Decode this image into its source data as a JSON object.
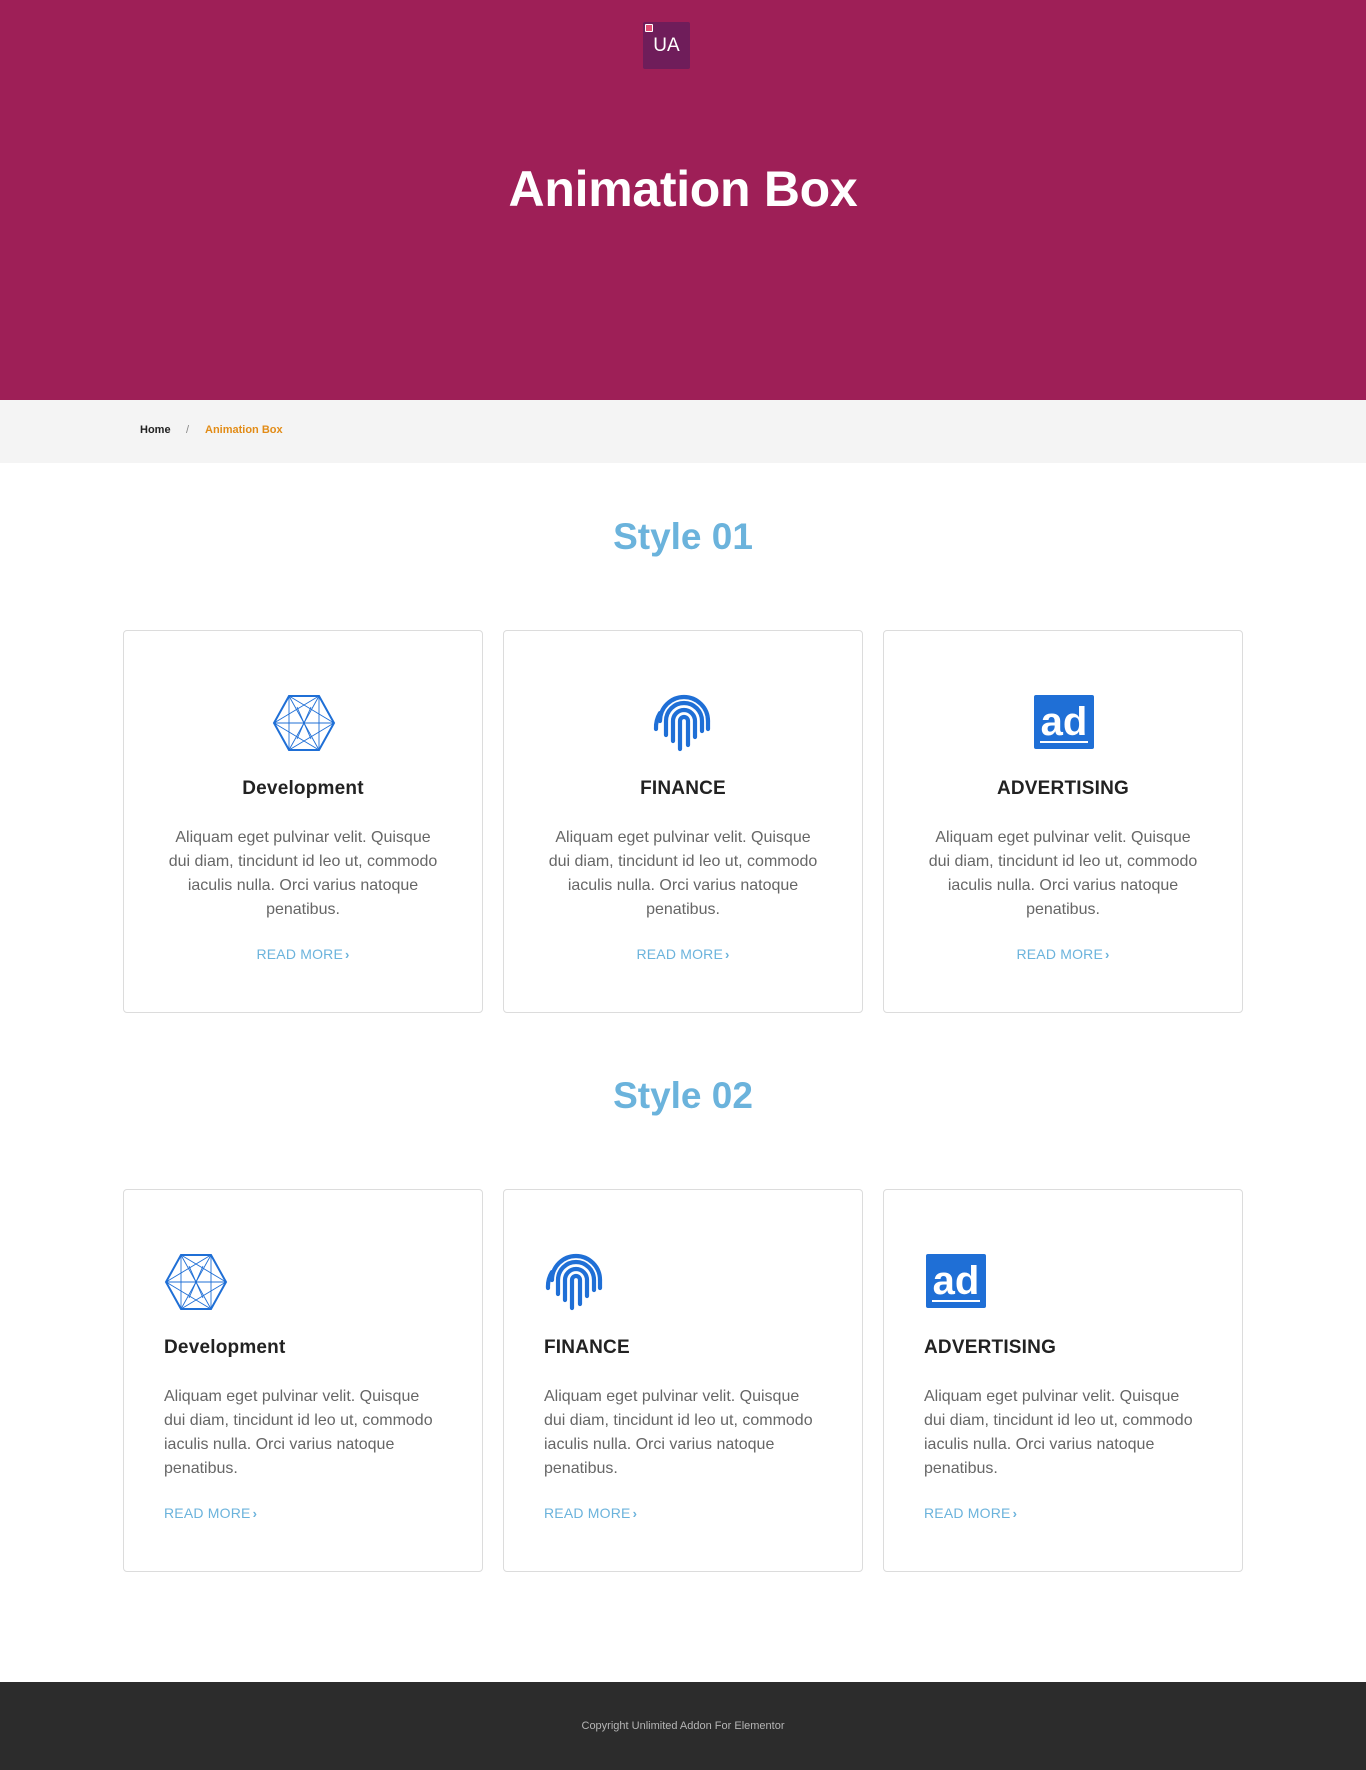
{
  "header": {
    "logo_text": "UA",
    "title": "Animation Box",
    "background_color": "#9e1f57"
  },
  "breadcrumb": {
    "home": "Home",
    "separator": "/",
    "current": "Animation Box"
  },
  "sections": [
    {
      "title": "Style 01",
      "alignment": "center",
      "cards": [
        {
          "icon": "hexagon-network-icon",
          "title": "Development",
          "text": "Aliquam eget pulvinar velit. Quisque dui diam, tincidunt id leo ut, commodo iaculis nulla. Orci varius natoque penatibus.",
          "link": "READ MORE"
        },
        {
          "icon": "fingerprint-icon",
          "title": "FINANCE",
          "text": "Aliquam eget pulvinar velit. Quisque dui diam, tincidunt id leo ut, commodo iaculis nulla. Orci varius natoque penatibus.",
          "link": "READ MORE"
        },
        {
          "icon": "ad-icon",
          "title": "ADVERTISING",
          "text": "Aliquam eget pulvinar velit. Quisque dui diam, tincidunt id leo ut, commodo iaculis nulla. Orci varius natoque penatibus.",
          "link": "READ MORE"
        }
      ]
    },
    {
      "title": "Style 02",
      "alignment": "left",
      "cards": [
        {
          "icon": "hexagon-network-icon",
          "title": "Development",
          "text": "Aliquam eget pulvinar velit. Quisque dui diam, tincidunt id leo ut, commodo iaculis nulla. Orci varius natoque penatibus.",
          "link": "READ MORE"
        },
        {
          "icon": "fingerprint-icon",
          "title": "FINANCE",
          "text": "Aliquam eget pulvinar velit. Quisque dui diam, tincidunt id leo ut, commodo iaculis nulla. Orci varius natoque penatibus.",
          "link": "READ MORE"
        },
        {
          "icon": "ad-icon",
          "title": "ADVERTISING",
          "text": "Aliquam eget pulvinar velit. Quisque dui diam, tincidunt id leo ut, commodo iaculis nulla. Orci varius natoque penatibus.",
          "link": "READ MORE"
        }
      ]
    }
  ],
  "colors": {
    "accent": "#6bb3dc",
    "icon_blue": "#1f6fd6",
    "breadcrumb_current": "#e28c17",
    "footer_bg": "#2c2c2c"
  },
  "footer": {
    "copyright": "Copyright Unlimited Addon For Elementor"
  }
}
